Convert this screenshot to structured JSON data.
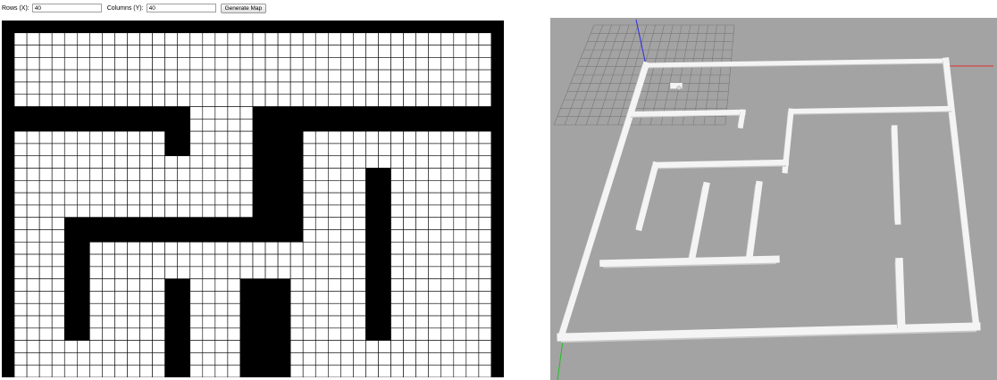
{
  "controls": {
    "rows_label": "Rows (X):",
    "rows_value": "40",
    "cols_label": "Columns (Y):",
    "cols_value": "40",
    "generate_label": "Generate Map"
  },
  "grid_map": {
    "cols": 40,
    "rows": 29,
    "obstacle_color": "#000000",
    "free_color": "#ffffff",
    "line_color": "#000000",
    "obstacles": [
      {
        "c0": 0,
        "r0": 0,
        "c1": 39,
        "r1": 0
      },
      {
        "c0": 0,
        "r0": 0,
        "c1": 0,
        "r1": 28
      },
      {
        "c0": 39,
        "r0": 0,
        "c1": 39,
        "r1": 28
      },
      {
        "c0": 1,
        "r0": 7,
        "c1": 14,
        "r1": 8
      },
      {
        "c0": 13,
        "r0": 9,
        "c1": 14,
        "r1": 10
      },
      {
        "c0": 20,
        "r0": 7,
        "c1": 38,
        "r1": 8
      },
      {
        "c0": 20,
        "r0": 9,
        "c1": 23,
        "r1": 17
      },
      {
        "c0": 5,
        "r0": 16,
        "c1": 22,
        "r1": 17
      },
      {
        "c0": 5,
        "r0": 18,
        "c1": 6,
        "r1": 25
      },
      {
        "c0": 29,
        "r0": 12,
        "c1": 30,
        "r1": 25
      },
      {
        "c0": 13,
        "r0": 21,
        "c1": 14,
        "r1": 28
      },
      {
        "c0": 19,
        "r0": 21,
        "c1": 22,
        "r1": 28
      }
    ]
  },
  "scene": {
    "background": "#a3a3a3",
    "floor_grid_color": "#787878",
    "wall_color": "#f4f4f4",
    "wall_shade_color": "#c9c9c9",
    "axis_x_color": "#e52b2b",
    "axis_y_color": "#1fbf1f",
    "axis_z_color": "#2b2be5"
  }
}
